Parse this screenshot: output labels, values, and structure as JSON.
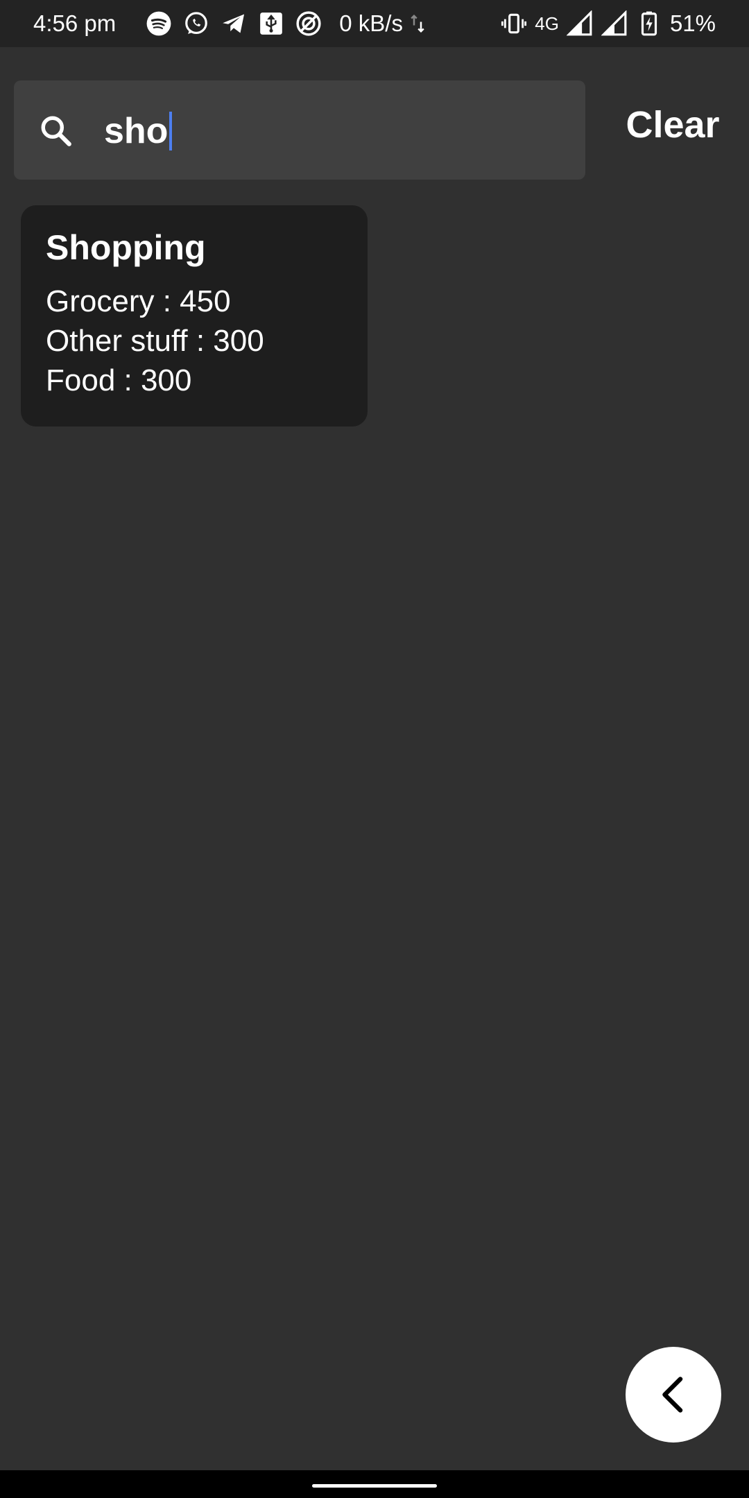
{
  "status_bar": {
    "time": "4:56 pm",
    "net_speed": "0 kB/s",
    "network_type": "4G",
    "battery": "51%",
    "icons_left": [
      "spotify-icon",
      "whatsapp-icon",
      "telegram-icon",
      "usb-icon",
      "vpn-icon"
    ],
    "icons_right": [
      "vibrate-icon",
      "signal-icon",
      "signal-icon",
      "battery-charging-icon"
    ]
  },
  "search": {
    "value": "sho",
    "clear_label": "Clear"
  },
  "results": [
    {
      "title": "Shopping",
      "items": [
        "Grocery : 450",
        "Other stuff : 300",
        "Food : 300"
      ]
    }
  ],
  "colors": {
    "background": "#303030",
    "status_bar": "#232323",
    "search_field": "#404040",
    "card": "#1e1e1e",
    "caret": "#4d7ff0",
    "fab": "#ffffff"
  }
}
